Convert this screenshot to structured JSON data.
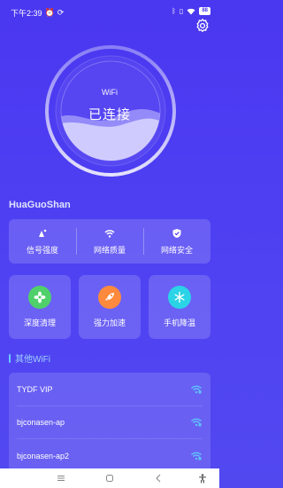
{
  "status_bar": {
    "time": "下午2:39",
    "battery": "88"
  },
  "gauge": {
    "network_type": "WiFi",
    "status": "已连接"
  },
  "network": {
    "ssid": "HuaGuoShan"
  },
  "metrics": [
    {
      "label": "信号强度",
      "icon": "signal-icon"
    },
    {
      "label": "网络质量",
      "icon": "wifi-quality-icon"
    },
    {
      "label": "网络安全",
      "icon": "shield-icon"
    }
  ],
  "tools": [
    {
      "label": "深度清理",
      "icon": "fan-icon",
      "color": "#4fd06a"
    },
    {
      "label": "强力加速",
      "icon": "rocket-icon",
      "color": "#ff8a3d"
    },
    {
      "label": "手机降温",
      "icon": "snowflake-icon",
      "color": "#2ad3e6"
    }
  ],
  "other_wifi": {
    "title": "其他WiFi",
    "items": [
      {
        "name": "TYDF VIP"
      },
      {
        "name": "bjconasen-ap"
      },
      {
        "name": "bjconasen-ap2"
      }
    ]
  },
  "colors": {
    "accent_blue": "#5fc4ff",
    "background": "#4a37f0"
  }
}
